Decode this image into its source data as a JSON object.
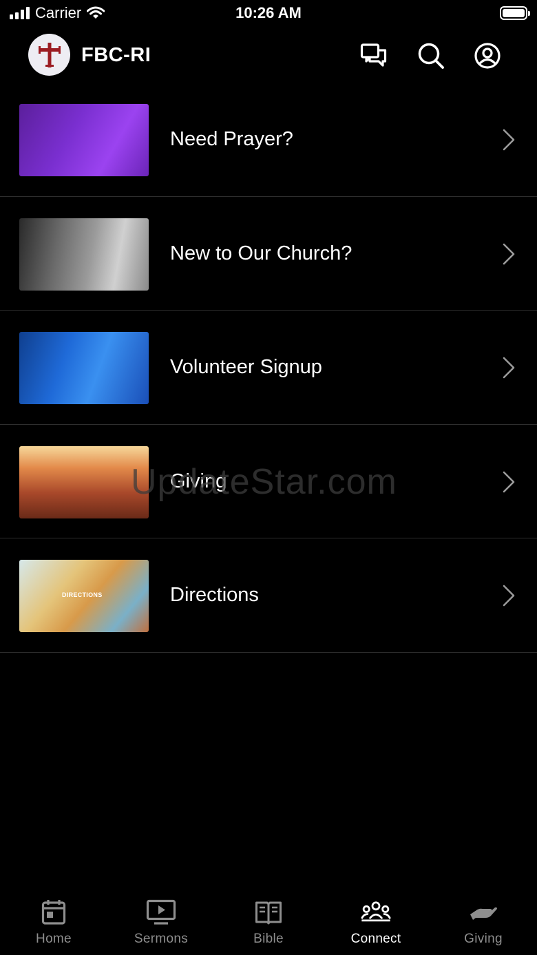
{
  "status_bar": {
    "carrier": "Carrier",
    "time": "10:26 AM"
  },
  "header": {
    "title": "FBC-RI",
    "icons": [
      "logo-cross-icon",
      "chat-icon",
      "search-icon",
      "profile-icon"
    ]
  },
  "items": [
    {
      "label": "Need Prayer?",
      "thumb": "prayer"
    },
    {
      "label": "New to Our Church?",
      "thumb": "new"
    },
    {
      "label": "Volunteer Signup",
      "thumb": "volunteer"
    },
    {
      "label": "Giving",
      "thumb": "giving"
    },
    {
      "label": "Directions",
      "thumb": "directions",
      "thumb_text": "DIRECTIONS"
    }
  ],
  "watermark": "UpdateStar.com",
  "tabs": [
    {
      "label": "Home",
      "icon": "calendar-icon",
      "active": false
    },
    {
      "label": "Sermons",
      "icon": "video-icon",
      "active": false
    },
    {
      "label": "Bible",
      "icon": "book-icon",
      "active": false
    },
    {
      "label": "Connect",
      "icon": "group-icon",
      "active": true
    },
    {
      "label": "Giving",
      "icon": "hand-icon",
      "active": false
    }
  ],
  "colors": {
    "background": "#000000",
    "divider": "#2e2e2e",
    "tab_inactive": "#8e8e8e",
    "tab_active": "#ffffff",
    "logo_cross": "#9b1c22"
  }
}
